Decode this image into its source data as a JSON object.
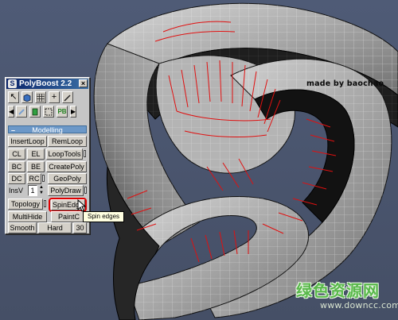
{
  "watermark": {
    "credit": "made by baochao",
    "site_cn": "绿色资源网",
    "site_url": "www.downcc.com"
  },
  "panel": {
    "title": "PolyBoost 2.2",
    "close": "×",
    "rollout": "Modelling",
    "rollout_sign": "–",
    "toolbar_row1": [
      "select-arrow-icon",
      "box-icon",
      "grid-icon",
      "plus-icon",
      "brush-icon"
    ],
    "toolbar_row2": [
      "left-arrow-icon",
      "pen-icon",
      "cylinder-icon",
      "transform-icon",
      "pb-icon",
      "right-arrow-icon"
    ],
    "pb_label": "PB",
    "buttons": {
      "insert_loop": "InsertLoop",
      "rem_loop": "RemLoop",
      "cl": "CL",
      "el": "EL",
      "loop_tools": "LoopTools",
      "bc": "BC",
      "be": "BE",
      "create_poly": "CreatePoly",
      "dc": "DC",
      "rc": "RC",
      "geo_poly": "GeoPoly",
      "ins_v": "InsV",
      "ins_v_value": "1",
      "poly_draw": "PolyDraw",
      "topology": "Topology",
      "spin_edge": "SpinEdge",
      "multi_hide": "MultiHide",
      "paint": "PaintC",
      "smooth": "Smooth",
      "hard": "Hard",
      "thirty": "30"
    },
    "tooltip": "Spin edges"
  },
  "colors": {
    "viewport_bg": "#4a5670",
    "mesh_light": "#c8c8c8",
    "mesh_dark": "#1a1a1a",
    "selected_edges": "#e01010",
    "panel_bg": "#c6c6c6",
    "title_bar": "#0a246a",
    "highlight": "#e00000",
    "tooltip_bg": "#ffffe1"
  }
}
